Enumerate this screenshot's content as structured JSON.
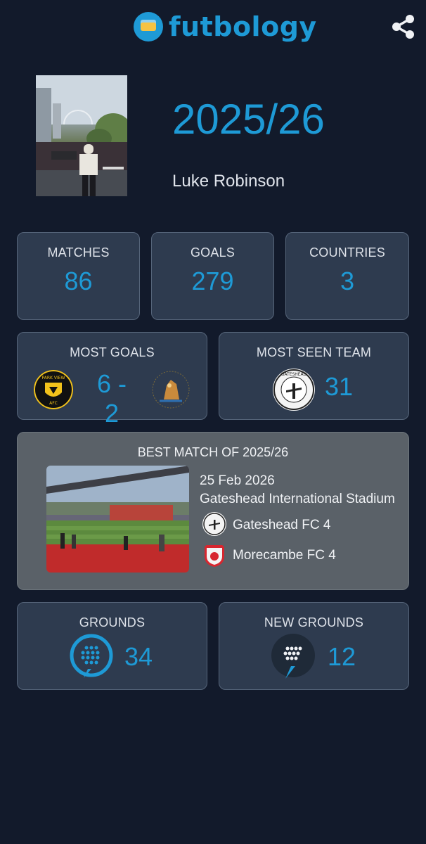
{
  "app": {
    "name": "futbology"
  },
  "profile": {
    "season": "2025/26",
    "name": "Luke Robinson"
  },
  "stats": {
    "matches": {
      "label": "MATCHES",
      "value": "86"
    },
    "goals": {
      "label": "GOALS",
      "value": "279"
    },
    "countries": {
      "label": "COUNTRIES",
      "value": "3"
    }
  },
  "most_goals": {
    "label": "MOST GOALS",
    "score": "6 - 2",
    "home_crest_text": "PARK VIEW",
    "home_crest_subtext": "AFC"
  },
  "most_seen_team": {
    "label": "MOST SEEN TEAM",
    "count": "31",
    "crest_text": "GATESHEAD"
  },
  "best_match": {
    "title": "BEST MATCH OF 2025/26",
    "date": "25 Feb 2026",
    "venue": "Gateshead International Stadium",
    "home": "Gateshead FC 4",
    "away": "Morecambe FC 4"
  },
  "grounds": {
    "label": "GROUNDS",
    "value": "34"
  },
  "new_grounds": {
    "label": "NEW GROUNDS",
    "value": "12"
  },
  "colors": {
    "accent": "#1e9ad6",
    "background": "#121a2b",
    "card": "#2e3b4f",
    "best_card": "#5a6168"
  },
  "icons": {
    "share": "share-icon",
    "grounds": "stadium-pin-icon",
    "new_grounds": "stadium-pin-icon"
  }
}
